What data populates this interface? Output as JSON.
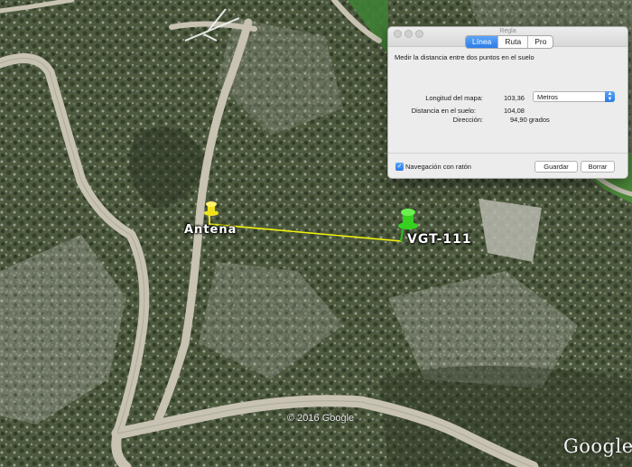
{
  "map": {
    "pin_a_label": "Antena",
    "pin_b_label": "VGT-111",
    "copyright": "© 2016 Google",
    "logo": "Google",
    "colors": {
      "line": "#f2f20a",
      "pin_a": "#f0e21a",
      "pin_b": "#35d11e"
    }
  },
  "ruler": {
    "title": "Regla",
    "tabs": [
      {
        "label": "Línea",
        "active": true
      },
      {
        "label": "Ruta",
        "active": false
      },
      {
        "label": "Pro",
        "active": false
      }
    ],
    "description": "Medir la distancia entre dos puntos en el suelo",
    "map_length_label": "Longitud del mapa:",
    "map_length_value": "103,36",
    "unit_selected": "Metros",
    "ground_distance_label": "Distancia en el suelo:",
    "ground_distance_value": "104,08",
    "direction_label": "Dirección:",
    "direction_value": "94,90 grados",
    "mouse_nav_label": "Navegación con ratón",
    "mouse_nav_checked": true,
    "save_label": "Guardar",
    "clear_label": "Borrar"
  }
}
